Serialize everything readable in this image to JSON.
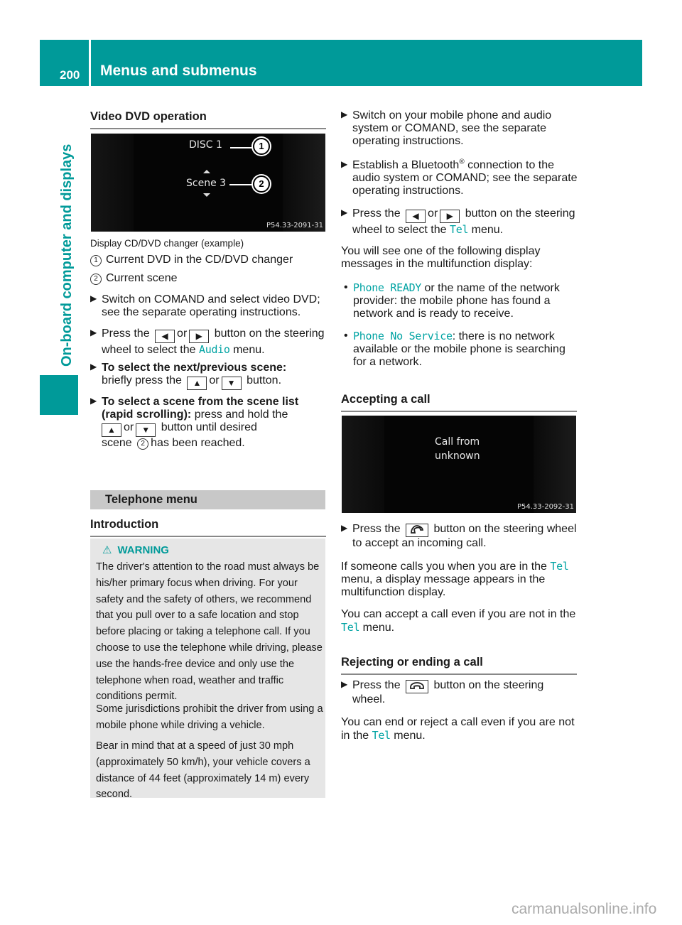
{
  "header": {
    "page_number": "200",
    "title": "Menus and submenus",
    "side_title": "On-board computer and displays",
    "brand_color": "#009a99"
  },
  "left": {
    "video_dvd": {
      "heading": "Video DVD operation",
      "screen": {
        "line1": "DISC 1",
        "line2": "Scene 3",
        "code": "P54.33-2091-31",
        "callout1": "1",
        "callout2": "2"
      },
      "caption": "Display CD/DVD changer (example)",
      "legend": [
        {
          "num": "1",
          "text": "Current DVD in the CD/DVD changer"
        },
        {
          "num": "2",
          "text": "Current scene"
        }
      ],
      "steps": {
        "s1": "Switch on COMAND and select video DVD; see the separate operating instructions.",
        "s2_a": "Press the",
        "s2_or": "or",
        "s2_b": "button on the steering wheel to select the",
        "s2_menu": "Audio",
        "s2_c": "menu.",
        "s3_bold": "To select the next/previous scene:",
        "s3_a": "briefly press the",
        "s3_or": "or",
        "s3_b": "button.",
        "s4_bold1": "To select a scene from the scene list",
        "s4_bold2": "(rapid scrolling):",
        "s4_a": "press and hold the",
        "s4_or": "or",
        "s4_b": "button until desired",
        "s4_c": "scene",
        "s4_num": "2",
        "s4_d": "has been reached."
      }
    },
    "telephone": {
      "band": "Telephone menu",
      "heading": "Introduction",
      "warning_title": "WARNING",
      "warning_paragraphs": [
        "The driver's attention to the road must always be his/her primary focus when driving. For your safety and the safety of others, we recommend that you pull over to a safe location and stop before placing or taking a telephone call. If you choose to use the telephone while driving, please use the hands-free device and only use the telephone when road, weather and traffic conditions permit.",
        "Some jurisdictions prohibit the driver from using a mobile phone while driving a vehicle.",
        "Bear in mind that at a speed of just 30 mph (approximately 50 km/h), your vehicle covers a distance of 44 feet (approximately 14 m) every second."
      ]
    }
  },
  "right": {
    "steps": {
      "s1": "Switch on your mobile phone and audio system or COMAND, see the separate operating instructions.",
      "s2_a": "Establish a Bluetooth",
      "s2_reg": "®",
      "s2_b": "connection to the audio system or COMAND; see the separate operating instructions.",
      "s3_a": "Press the",
      "s3_or": "or",
      "s3_b": "button on the steering wheel to select the",
      "s3_menu": "Tel",
      "s3_c": "menu."
    },
    "intro_text": "You will see one of the following display messages in the multifunction display:",
    "messages": [
      {
        "code": "Phone READY",
        "text": "or the name of the network provider: the mobile phone has found a network and is ready to receive."
      },
      {
        "code": "Phone No Service",
        "text": ": there is no network available or the mobile phone is searching for a network."
      }
    ],
    "accepting": {
      "heading": "Accepting a call",
      "screen": {
        "line1": "Call from",
        "line2": "unknown",
        "code": "P54.33-2092-31"
      },
      "step_a": "Press the",
      "step_b": "button on the steering wheel to accept an incoming call.",
      "p1_a": "If someone calls you when you are in the",
      "p1_menu": "Tel",
      "p1_b": "menu, a display message appears in the multifunction display.",
      "p2_a": "You can accept a call even if you are not in the",
      "p2_menu": "Tel",
      "p2_b": "menu."
    },
    "rejecting": {
      "heading": "Rejecting or ending a call",
      "step_a": "Press the",
      "step_b": "button on the steering wheel.",
      "p1_a": "You can end or reject a call even if you are not in the",
      "p1_menu": "Tel",
      "p1_b": "menu."
    }
  },
  "footer": {
    "watermark": "carmanualsonline.info"
  },
  "icons": {
    "bullet_arrow": "▶",
    "key_left": "◀",
    "key_right": "▶",
    "key_up": "▲",
    "key_down": "▼",
    "dot": "•",
    "warning": "⚠"
  }
}
